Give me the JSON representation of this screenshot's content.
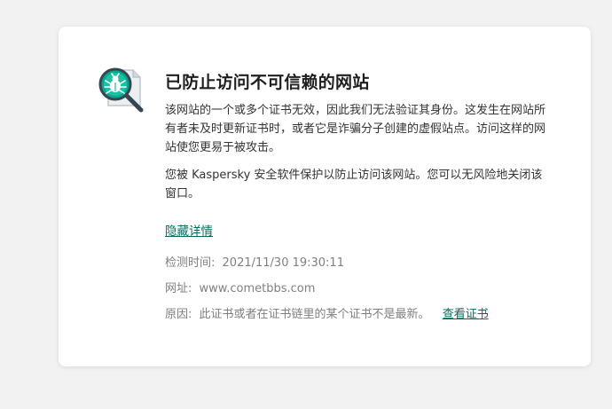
{
  "page": {
    "title": "已防止访问不可信赖的网站",
    "paragraph1": "该网站的一个或多个证书无效，因此我们无法验证其身份。这发生在网站所有者未及时更新证书时，或者它是诈骗分子创建的虚假站点。访问这样的网站使您更易于被攻击。",
    "paragraph2": "您被 Kaspersky 安全软件保护以防止访问该网站。您可以无风险地关闭该窗口。",
    "hide_details_label": "隐藏详情"
  },
  "details": {
    "time_label": "检测时间:",
    "time_value": "2021/11/30 19:30:11",
    "url_label": "网址:",
    "url_value": "www.cometbbs.com",
    "reason_label": "原因:",
    "reason_value": "此证书或者在证书链里的某个证书不是最新。",
    "view_certificate_label": "查看证书"
  },
  "icon": {
    "name": "bug-magnifier-icon",
    "accent_color": "#00a88e",
    "handle_color": "#37474f"
  },
  "colors": {
    "link": "#006d5b",
    "meta_text": "#808080"
  }
}
